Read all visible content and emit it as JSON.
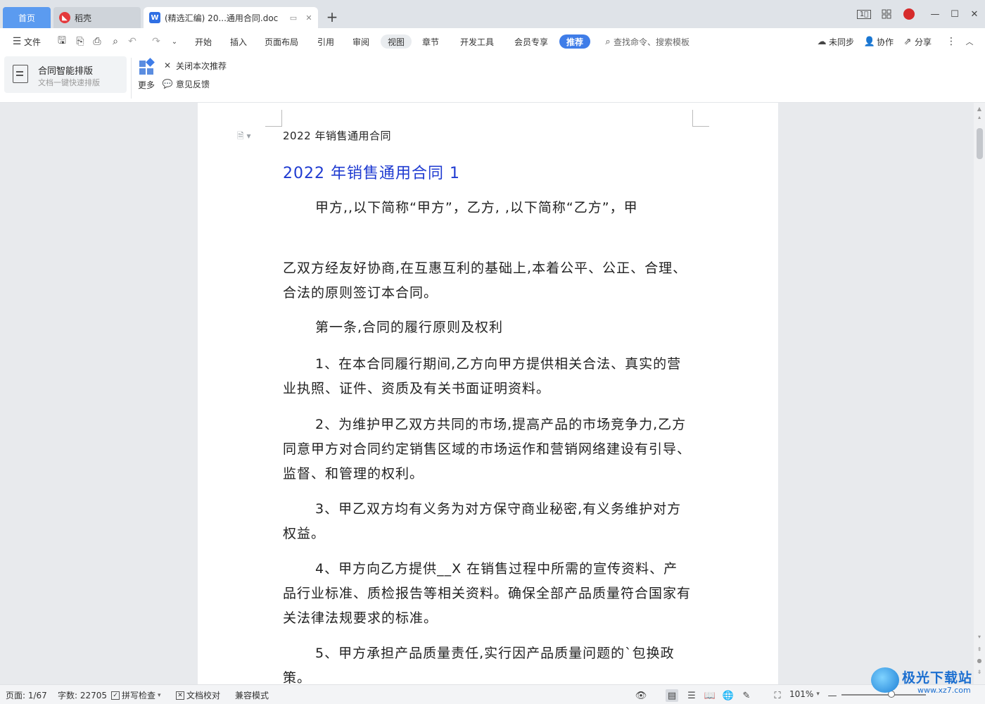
{
  "tabs": {
    "home": "首页",
    "daoke": "稻壳",
    "doc": "(精选汇编) 20...通用合同.doc"
  },
  "menubar": {
    "file": "文件",
    "items": [
      "开始",
      "插入",
      "页面布局",
      "引用",
      "审阅",
      "视图",
      "章节",
      "开发工具",
      "会员专享"
    ],
    "recommend": "推荐",
    "search_placeholder": "查找命令、搜索模板",
    "sync": "未同步",
    "collab": "协作",
    "share": "分享"
  },
  "ribbon": {
    "card_title": "合同智能排版",
    "card_subtitle": "文档一键快速排版",
    "more": "更多",
    "close_rec": "关闭本次推荐",
    "feedback": "意见反馈"
  },
  "document": {
    "header": "2022 年销售通用合同",
    "heading": "2022 年销售通用合同 1",
    "paragraphs": [
      "甲方,,以下简称“甲方”，乙方, ,以下简称“乙方”，甲",
      "乙双方经友好协商,在互惠互利的基础上,本着公平、公正、合理、合法的原则签订本合同。",
      "第一条,合同的履行原则及权利",
      "1、在本合同履行期间,乙方向甲方提供相关合法、真实的营业执照、证件、资质及有关书面证明资料。",
      "2、为维护甲乙双方共同的市场,提高产品的市场竞争力,乙方同意甲方对合同约定销售区域的市场运作和营销网络建设有引导、监督、和管理的权利。",
      "3、甲乙双方均有义务为对方保守商业秘密,有义务维护对方权益。",
      "4、甲方向乙方提供__X 在销售过程中所需的宣传资料、产品行业标准、质检报告等相关资料。确保全部产品质量符合国家有关法律法规要求的标准。",
      "5、甲方承担产品质量责任,实行因产品质量问题的`包换政策。"
    ]
  },
  "status": {
    "page": "页面: 1/67",
    "words": "字数: 22705",
    "spell": "拼写检查",
    "proof": "文档校对",
    "compat": "兼容模式",
    "zoom": "101%"
  },
  "watermark": {
    "name": "极光下载站",
    "url": "www.xz7.com"
  }
}
